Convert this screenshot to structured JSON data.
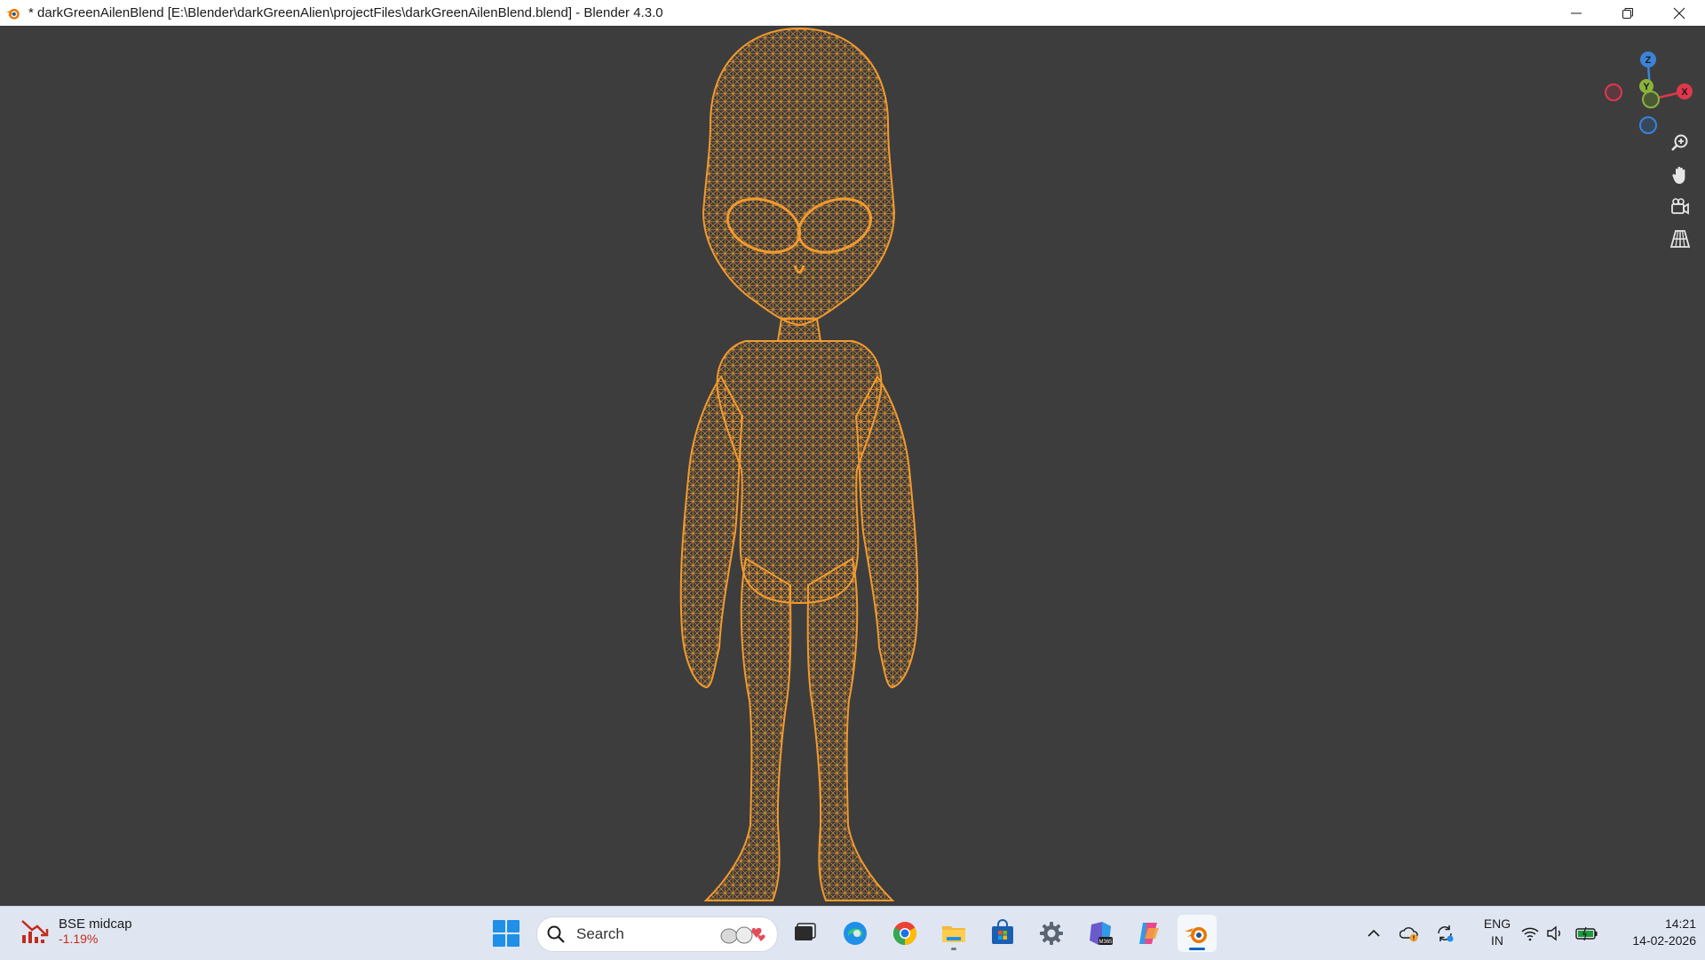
{
  "window": {
    "title": "* darkGreenAilenBlend [E:\\Blender\\darkGreenAlien\\projectFiles\\darkGreenAilenBlend.blend] - Blender 4.3.0"
  },
  "colors": {
    "viewport_bg": "#3d3d3d",
    "wireframe": "#f29a2e",
    "axis_x": "#e0374d",
    "axis_y": "#8ab33a",
    "axis_z": "#3c83d6"
  },
  "gizmo": {
    "x_label": "X",
    "y_label": "Y",
    "z_label": "Z"
  },
  "nav_tools": [
    "zoom-icon",
    "pan-hand-icon",
    "camera-view-icon",
    "perspective-grid-icon"
  ],
  "taskbar": {
    "widget": {
      "title": "BSE midcap",
      "value": "-1.19%"
    },
    "search": {
      "placeholder": "Search"
    },
    "apps": [
      "task-view",
      "edge",
      "chrome",
      "file-explorer",
      "microsoft-store",
      "settings",
      "microsoft-365",
      "copilot",
      "blender"
    ],
    "language": {
      "line1": "ENG",
      "line2": "IN"
    },
    "clock": {
      "time": "14:21",
      "date": "14-02-2026"
    }
  }
}
